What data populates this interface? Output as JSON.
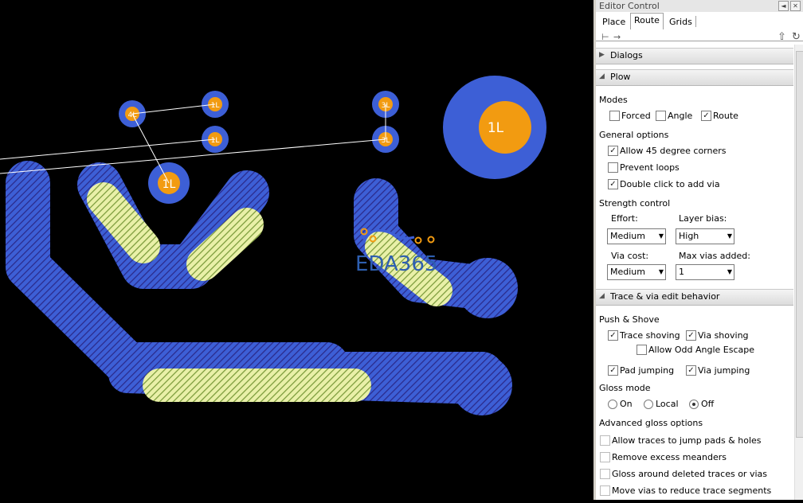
{
  "canvas": {
    "watermark": "EDA365",
    "pad_labels": {
      "p1": "4L",
      "p2": "1L",
      "p3": "1L",
      "p4": "3L",
      "p5": "3L",
      "p6": "1L",
      "p7": "1L"
    },
    "colors": {
      "copper": "#3d5fd6",
      "pad": "#f29b11",
      "background": "#000000",
      "ratsnest": "#ffffff",
      "hatch": "#e9f0a8"
    }
  },
  "panel": {
    "title": "Editor Control",
    "tabs": [
      {
        "label": "Place"
      },
      {
        "label": "Route"
      },
      {
        "label": "Grids"
      }
    ],
    "sections": {
      "dialogs": "Dialogs",
      "plow": "Plow",
      "trace_via": "Trace & via edit behavior"
    },
    "modes": {
      "label": "Modes",
      "forced": "Forced",
      "angle": "Angle",
      "route": "Route"
    },
    "general": {
      "label": "General options",
      "allow45": "Allow 45 degree corners",
      "prevent_loops": "Prevent loops",
      "double_click": "Double click to add via"
    },
    "strength": {
      "label": "Strength control",
      "effort_label": "Effort:",
      "effort_value": "Medium",
      "layer_bias_label": "Layer bias:",
      "layer_bias_value": "High",
      "via_cost_label": "Via cost:",
      "via_cost_value": "Medium",
      "max_vias_label": "Max vias added:",
      "max_vias_value": "1"
    },
    "push_shove": {
      "label": "Push & Shove",
      "trace_shoving": "Trace shoving",
      "via_shoving": "Via shoving",
      "odd_angle": "Allow Odd Angle Escape",
      "pad_jumping": "Pad jumping",
      "via_jumping": "Via jumping"
    },
    "gloss": {
      "label": "Gloss mode",
      "on": "On",
      "local": "Local",
      "off": "Off"
    },
    "advanced": {
      "label": "Advanced gloss options",
      "jump_pads": "Allow traces to jump pads & holes",
      "meanders": "Remove excess meanders",
      "gloss_deleted": "Gloss around deleted traces or vias",
      "move_vias": "Move vias to reduce trace segments"
    }
  }
}
